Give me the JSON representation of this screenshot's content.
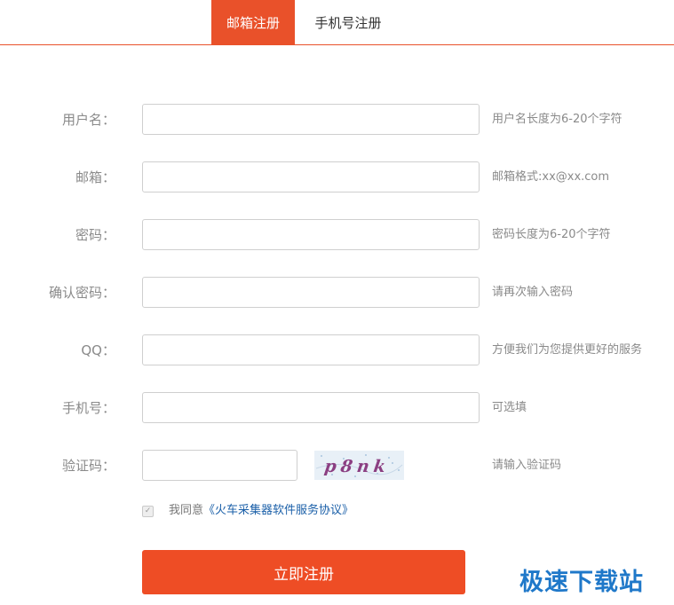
{
  "tabs": {
    "email": "邮箱注册",
    "phone": "手机号注册"
  },
  "form": {
    "username": {
      "label": "用户名：",
      "hint": "用户名长度为6-20个字符",
      "value": ""
    },
    "email": {
      "label": "邮箱：",
      "hint": "邮箱格式:xx@xx.com",
      "value": ""
    },
    "password": {
      "label": "密码：",
      "hint": "密码长度为6-20个字符",
      "value": ""
    },
    "confirm": {
      "label": "确认密码：",
      "hint": "请再次输入密码",
      "value": ""
    },
    "qq": {
      "label": "QQ：",
      "hint": "方便我们为您提供更好的服务",
      "value": ""
    },
    "phone": {
      "label": "手机号：",
      "hint": "可选填",
      "value": ""
    },
    "captcha": {
      "label": "验证码：",
      "hint": "请输入验证码",
      "value": "",
      "image_text": "p8nk"
    }
  },
  "agreement": {
    "prefix": "我同意",
    "link": "《火车采集器软件服务协议》",
    "checked": true
  },
  "submit_label": "立即注册",
  "watermark": "极速下载站",
  "colors": {
    "accent": "#e9512a",
    "link": "#1a5fa8",
    "watermark": "#1f78c9"
  }
}
